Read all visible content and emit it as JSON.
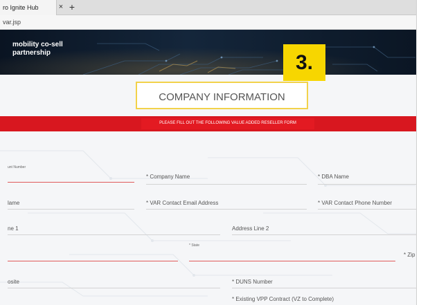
{
  "browser": {
    "tab_title": "ro Ignite Hub",
    "tab_close": "×",
    "tab_new": "+",
    "url": "var.jsp"
  },
  "hero": {
    "line1": "mobility co-sell",
    "line2": "partnership"
  },
  "step_badge": "3.",
  "section_title": "COMPANY INFORMATION",
  "banner_text": "PLEASE FILL OUT THE FOLLOWING VALUE ADDED RESELLER FORM",
  "form": {
    "account_number": "unt Number",
    "company_name": "* Company Name",
    "dba_name": "* DBA Name",
    "contact_name": "lame",
    "contact_email": "* VAR Contact Email Address",
    "contact_phone": "* VAR Contact Phone Number",
    "address_line1": "ne 1",
    "address_line2": "Address Line 2",
    "state": "* State",
    "zip": "* Zip",
    "website": "osite",
    "duns": "* DUNS Number",
    "existing_vpp": "* Existing VPP Contract (VZ to Complete)"
  },
  "colors": {
    "accent_red": "#d8171f",
    "badge_yellow": "#f7d600",
    "hero_dark": "#0d1a2b"
  }
}
